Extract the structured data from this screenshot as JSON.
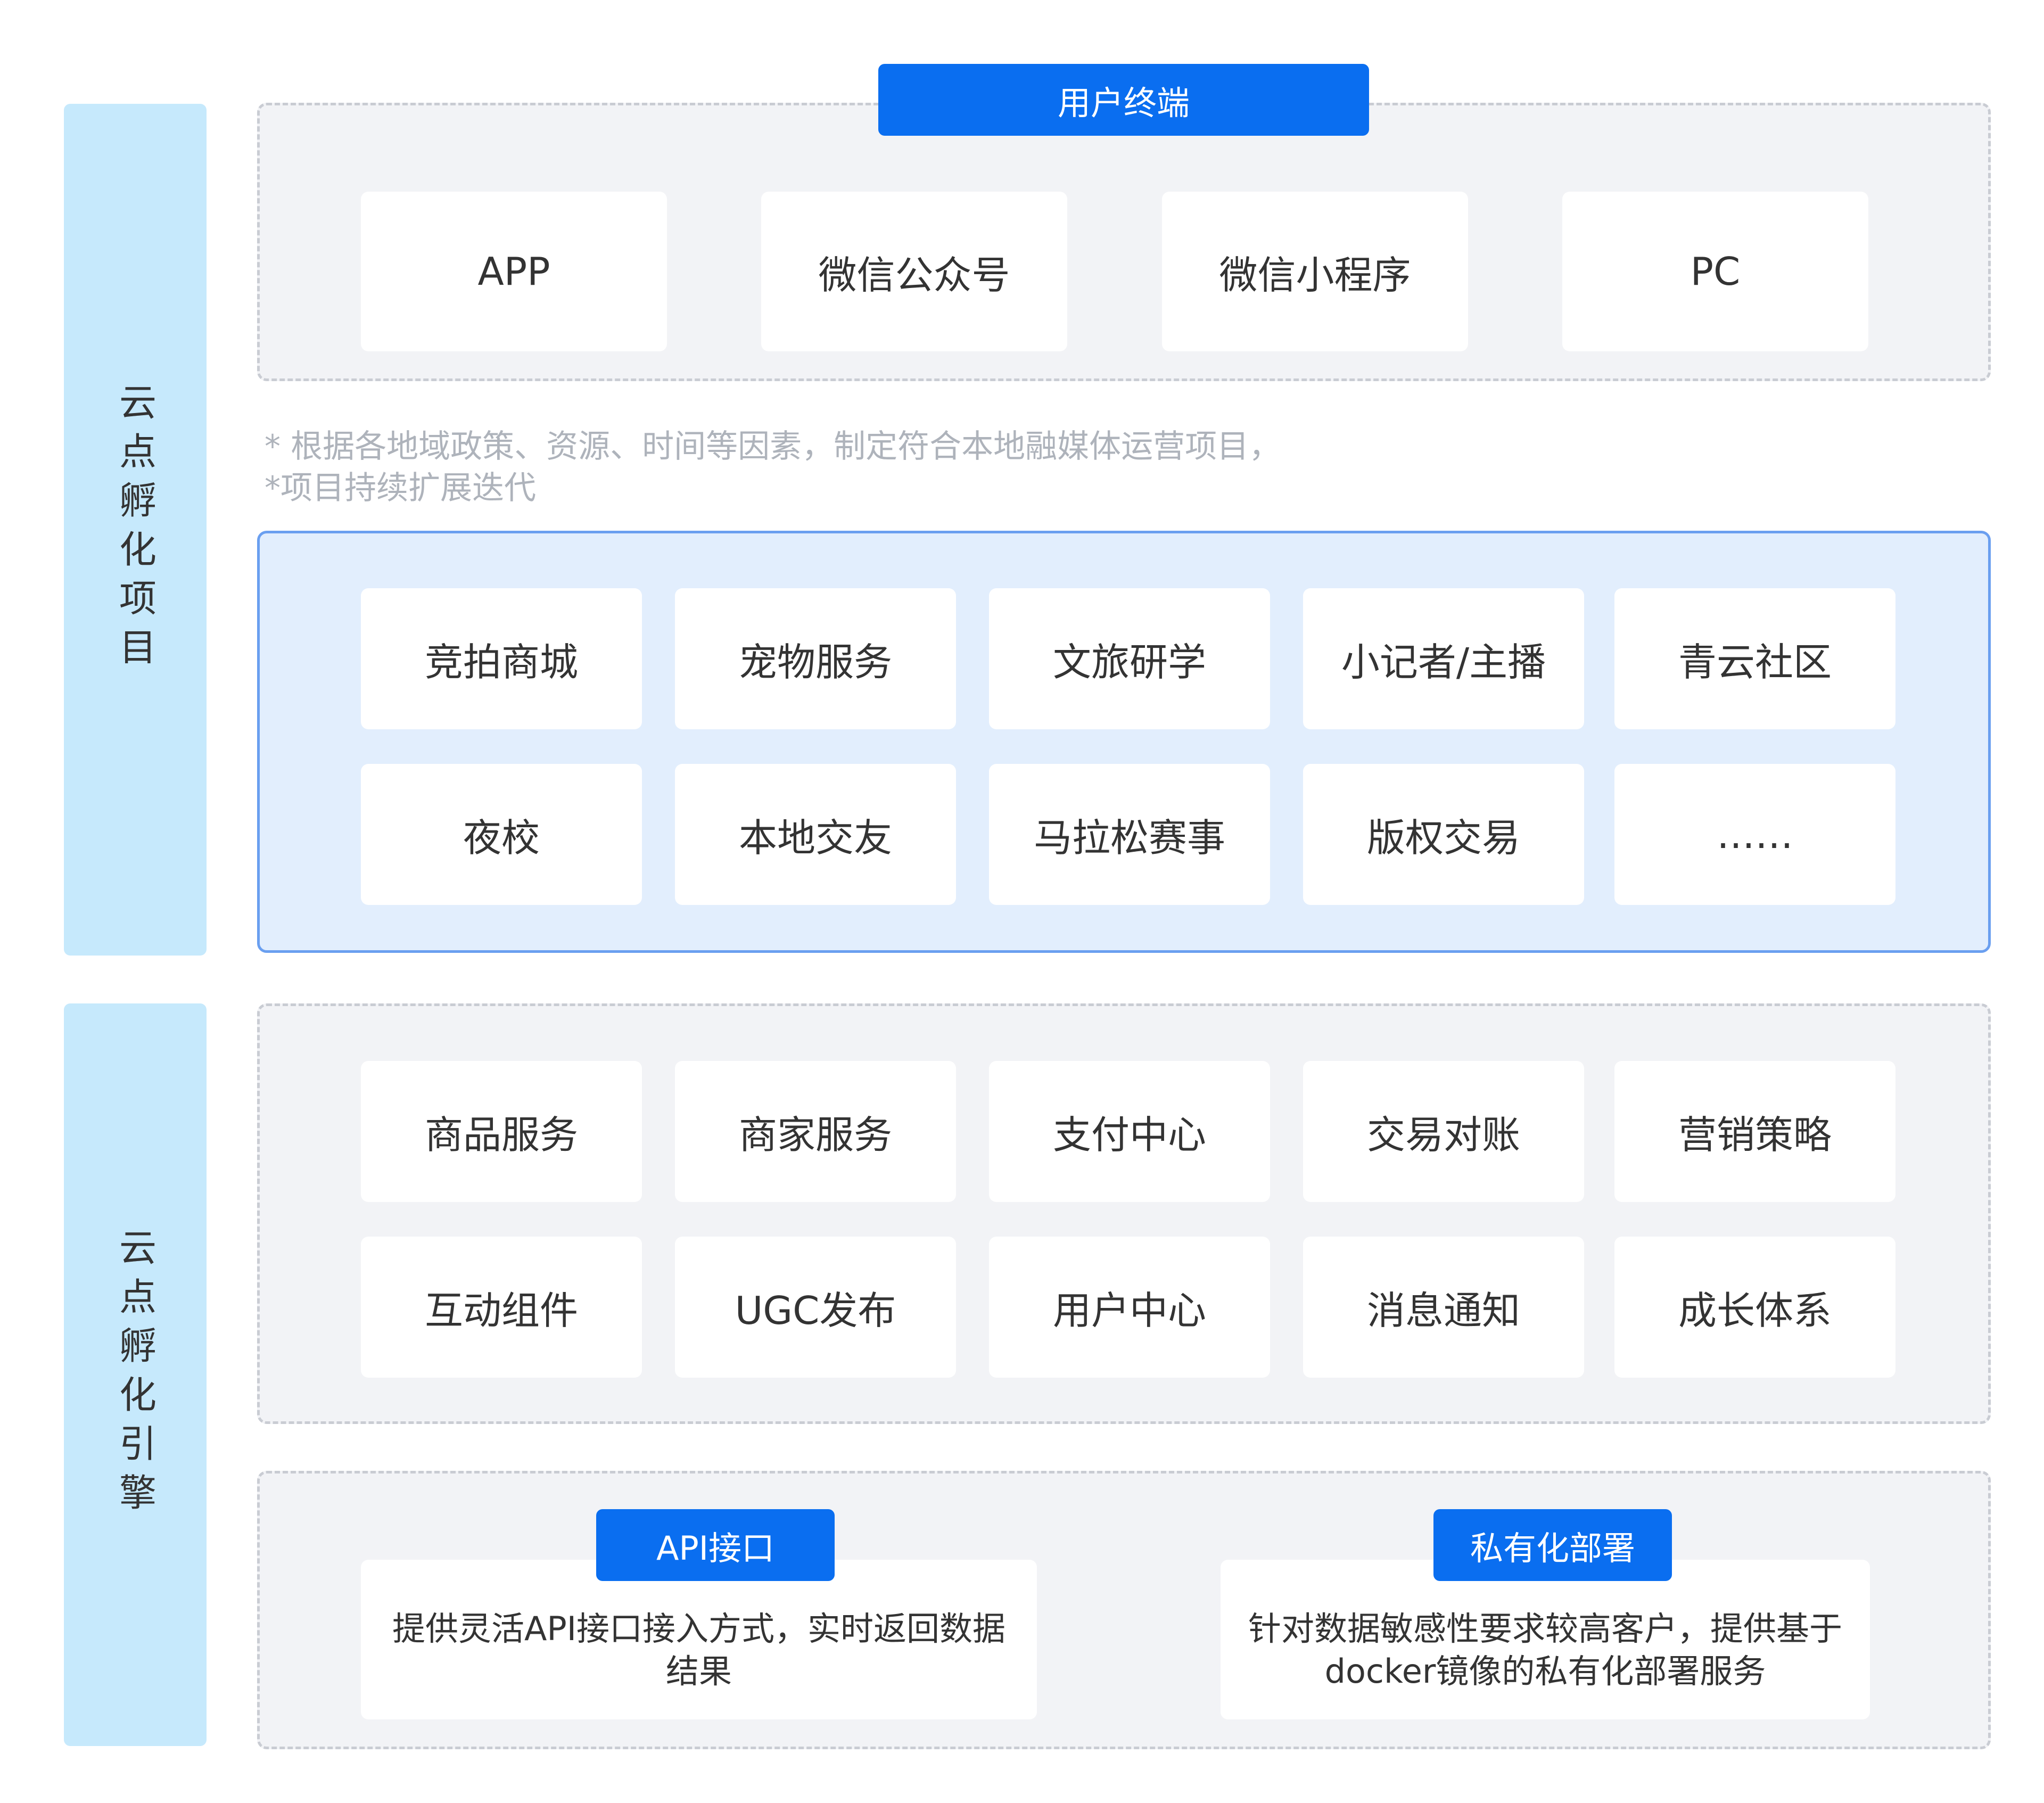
{
  "side_labels": {
    "top": "云点孵化项目",
    "bottom": "云点孵化引擎"
  },
  "user_terminal": {
    "title": "用户终端",
    "items": [
      "APP",
      "微信公众号",
      "微信小程序",
      "PC"
    ]
  },
  "notes": [
    "* 根据各地域政策、资源、时间等因素，制定符合本地融媒体运营项目，",
    "*项目持续扩展迭代"
  ],
  "projects": {
    "row1": [
      "竞拍商城",
      "宠物服务",
      "文旅研学",
      "小记者/主播",
      "青云社区"
    ],
    "row2": [
      "夜校",
      "本地交友",
      "马拉松赛事",
      "版权交易",
      "……"
    ]
  },
  "engine": {
    "row1": [
      "商品服务",
      "商家服务",
      "支付中心",
      "交易对账",
      "营销策略"
    ],
    "row2": [
      "互动组件",
      "UGC发布",
      "用户中心",
      "消息通知",
      "成长体系"
    ]
  },
  "deployment": {
    "api": {
      "title": "API接口",
      "description": "提供灵活API接口接入方式，实时返回数据结果"
    },
    "private": {
      "title": "私有化部署",
      "description": "针对数据敏感性要求较高客户，提供基于docker镜像的私有化部署服务"
    }
  },
  "colors": {
    "accent_blue": "#0a6ef0",
    "side_label_bg": "#c6e9fc",
    "panel_bg": "#f2f3f6",
    "projects_bg": "#e2eefd",
    "projects_border": "#6a9ff0",
    "note_text": "#aeb3bb"
  }
}
